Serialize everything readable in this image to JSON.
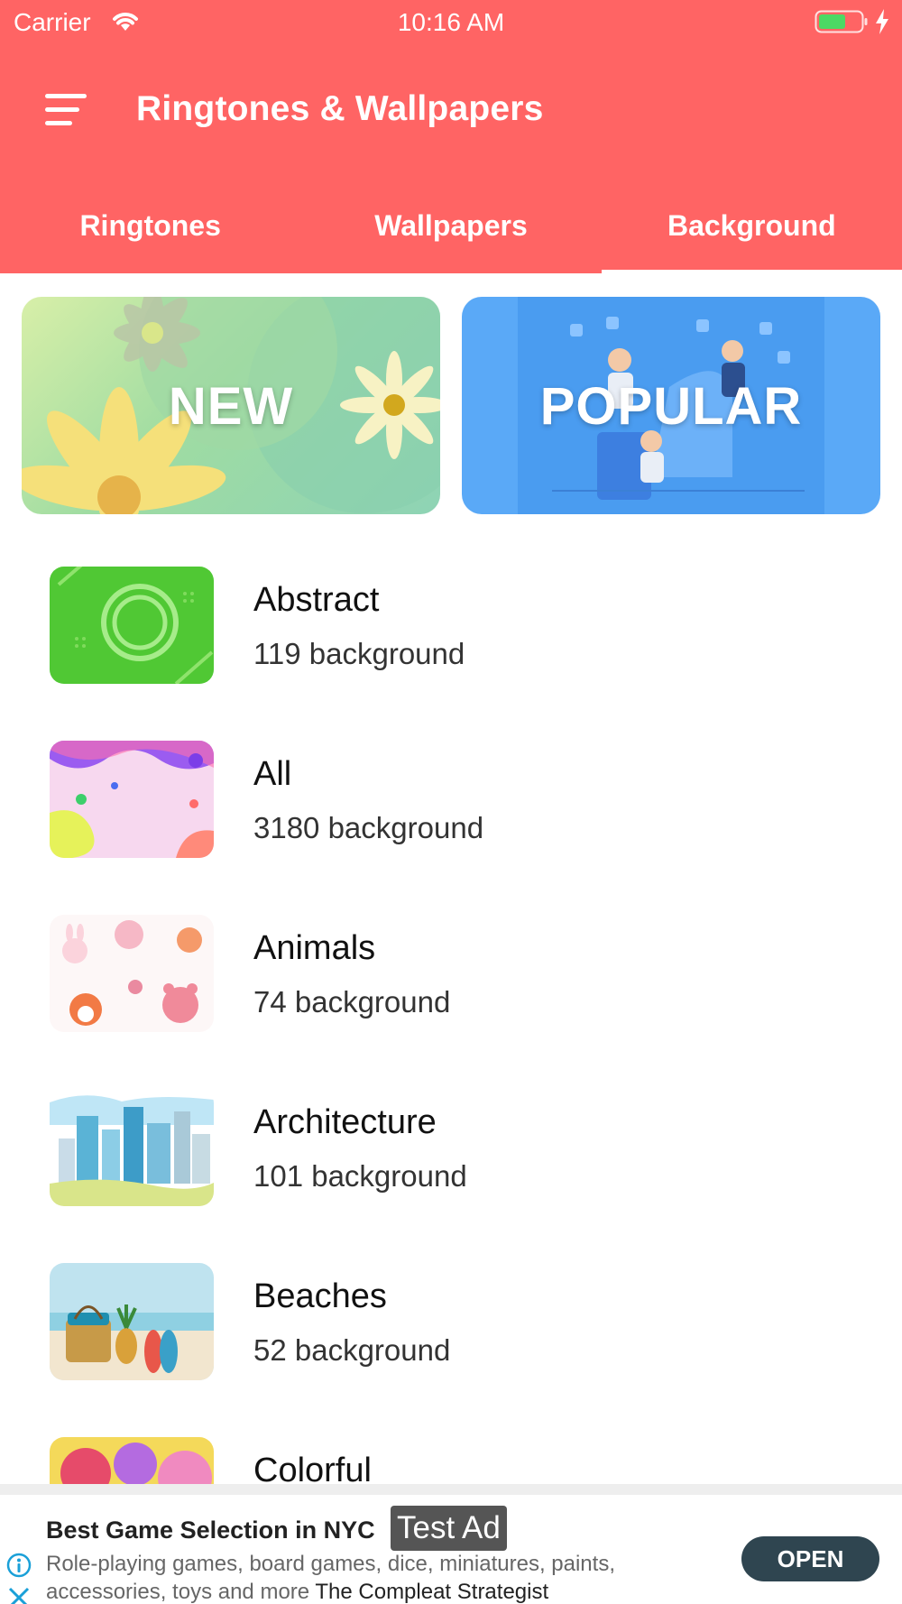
{
  "status_bar": {
    "carrier": "Carrier",
    "time": "10:16 AM"
  },
  "header": {
    "title": "Ringtones & Wallpapers",
    "menu_icon": "hamburger-menu-icon",
    "background_color": "#ff6464"
  },
  "tabs": [
    {
      "label": "Ringtones",
      "selected": false
    },
    {
      "label": "Wallpapers",
      "selected": false
    },
    {
      "label": "Background",
      "selected": true
    }
  ],
  "banners": {
    "new_label": "NEW",
    "popular_label": "POPULAR"
  },
  "categories": [
    {
      "name": "Abstract",
      "count": "119 background",
      "thumb": "green-rings-thumbnail"
    },
    {
      "name": "All",
      "count": "3180 background",
      "thumb": "pastel-bubbles-thumbnail"
    },
    {
      "name": "Animals",
      "count": "74 background",
      "thumb": "cute-animals-thumbnail"
    },
    {
      "name": "Architecture",
      "count": "101 background",
      "thumb": "city-skyline-thumbnail"
    },
    {
      "name": "Beaches",
      "count": "52 background",
      "thumb": "beach-bag-thumbnail"
    },
    {
      "name": "Colorful",
      "count": "",
      "thumb": "paint-splash-thumbnail"
    }
  ],
  "ad": {
    "title": "Best Game Selection in NYC",
    "test_label": "Test Ad",
    "description": "Role-playing games, board games, dice, miniatures, paints, accessories, toys and more",
    "advertiser": "The Compleat Strategist",
    "cta": "OPEN",
    "cta_color": "#2f4550"
  }
}
